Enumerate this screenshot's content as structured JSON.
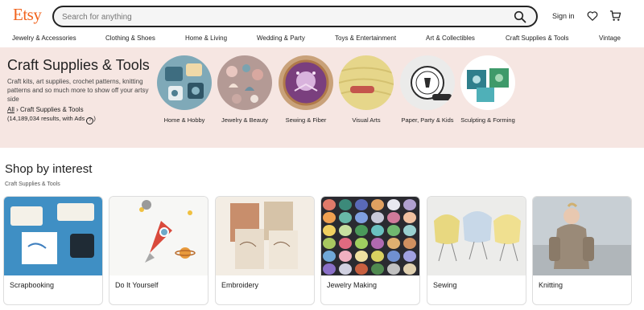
{
  "header": {
    "logo": "Etsy",
    "search_placeholder": "Search for anything",
    "signin": "Sign in",
    "colors": {
      "brand": "#f1641e"
    }
  },
  "nav": {
    "categories": [
      "Jewelry & Accessories",
      "Clothing & Shoes",
      "Home & Living",
      "Wedding & Party",
      "Toys & Entertainment",
      "Art & Collectibles",
      "Craft Supplies & Tools",
      "Vintage"
    ]
  },
  "hero": {
    "title": "Craft Supplies & Tools",
    "description": "Craft kits, art supplies, crochet patterns, knitting patterns and so much more to show off your artsy side",
    "breadcrumb_all": "All",
    "breadcrumb_current": "Craft Supplies & Tools",
    "results": "(14,189,034 results, with Ads",
    "subcategories": [
      {
        "label": "Home & Hobby",
        "icon": "stamps-image"
      },
      {
        "label": "Jewelry & Beauty",
        "icon": "earrings-image"
      },
      {
        "label": "Sewing & Fiber",
        "icon": "embroidery-hoop-image"
      },
      {
        "label": "Visual Arts",
        "icon": "yarn-image"
      },
      {
        "label": "Paper, Party & Kids",
        "icon": "stamp-seal-image"
      },
      {
        "label": "Sculpting & Forming",
        "icon": "tiles-image"
      }
    ]
  },
  "shop_by_interest": {
    "title": "Shop by interest",
    "subtitle": "Craft Supplies & Tools",
    "cards": [
      {
        "label": "Scrapbooking"
      },
      {
        "label": "Do It Yourself"
      },
      {
        "label": "Embroidery"
      },
      {
        "label": "Jewelry Making"
      },
      {
        "label": "Sewing"
      },
      {
        "label": "Knitting"
      }
    ]
  }
}
